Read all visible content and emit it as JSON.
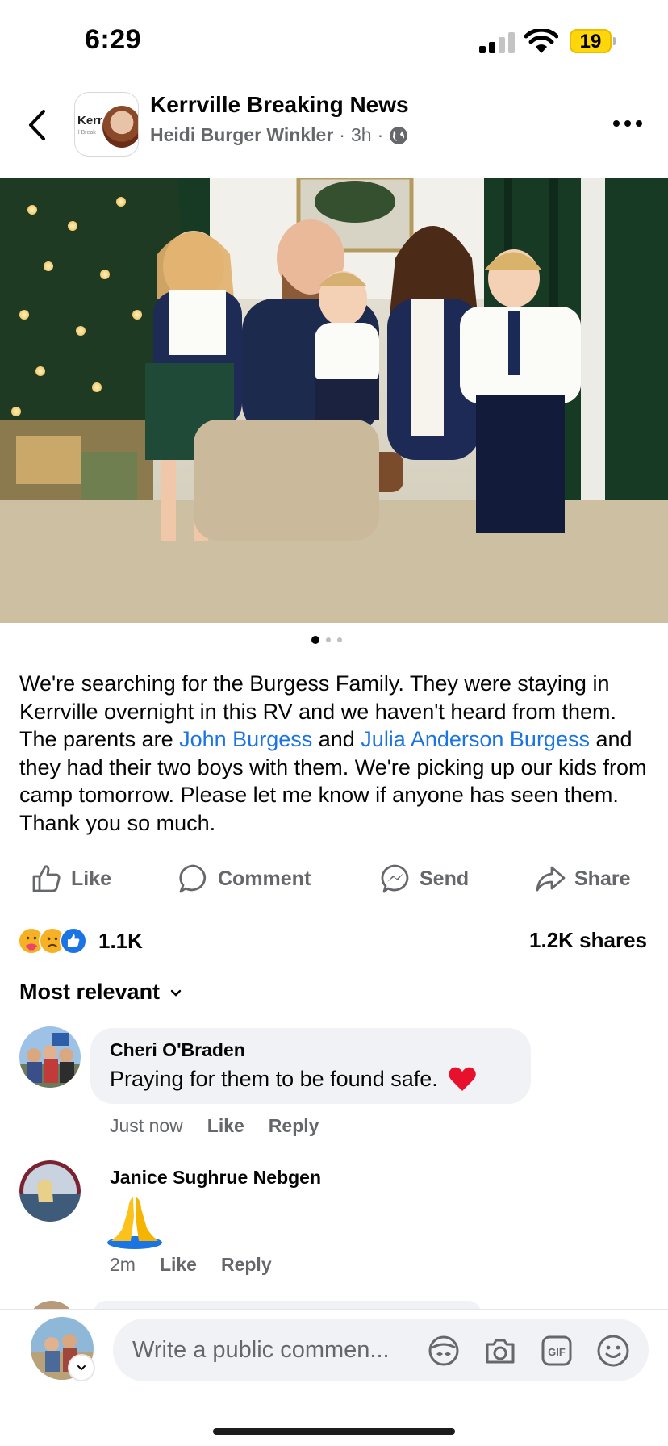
{
  "status_bar": {
    "time": "6:29",
    "battery": "19"
  },
  "header": {
    "page_name": "Kerrville Breaking News",
    "author": "Heidi Burger Winkler",
    "time_ago": "3h",
    "separator": "·",
    "avatar_text": "Kerr",
    "avatar_subtext": "l Break"
  },
  "photo": {
    "carousel_total": 3,
    "carousel_active": 1
  },
  "post": {
    "caption_parts": {
      "p1": "We're searching for the Burgess Family. They were staying in Kerrville overnight in this RV and we haven't heard from them. The parents are ",
      "tag1": "John Burgess",
      "p2": " and ",
      "tag2": "Julia Anderson Burgess",
      "p3": " and they had their two boys with them. We're picking up our kids from camp tomorrow. Please let me know if anyone has seen them. Thank you so much."
    }
  },
  "actions": {
    "like": "Like",
    "comment": "Comment",
    "send": "Send",
    "share": "Share"
  },
  "stats": {
    "reactions": "1.1K",
    "shares": "1.2K shares"
  },
  "sort": {
    "label": "Most relevant"
  },
  "comments": [
    {
      "name": "Cheri O'Braden",
      "text": "Praying for them to be found safe.",
      "time": "Just now",
      "like": "Like",
      "reply": "Reply"
    },
    {
      "name": "Janice Sughrue Nebgen",
      "text": "",
      "time": "2m",
      "like": "Like",
      "reply": "Reply"
    }
  ],
  "composer": {
    "placeholder": "Write a public commen..."
  },
  "colors": {
    "link": "#1b74e4",
    "secondary_text": "#65676b",
    "bubble": "#f0f2f5",
    "battery": "#ffd60a"
  }
}
